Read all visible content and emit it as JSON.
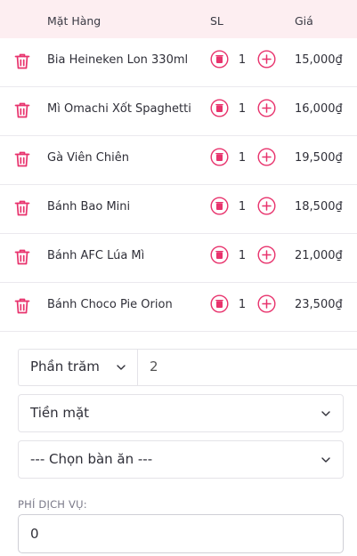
{
  "header": {
    "item": "Mặt Hàng",
    "qty": "SL",
    "price": "Giá"
  },
  "items": [
    {
      "name": "Bia Heineken Lon 330ml",
      "qty": "1",
      "price": "15,000₫"
    },
    {
      "name": "Mì Omachi Xốt Spaghetti",
      "qty": "1",
      "price": "16,000₫"
    },
    {
      "name": "Gà Viên Chiên",
      "qty": "1",
      "price": "19,500₫"
    },
    {
      "name": "Bánh Bao Mini",
      "qty": "1",
      "price": "18,500₫"
    },
    {
      "name": "Bánh AFC Lúa Mì",
      "qty": "1",
      "price": "21,000₫"
    },
    {
      "name": "Bánh Choco Pie Orion",
      "qty": "1",
      "price": "23,500₫"
    }
  ],
  "discount": {
    "type": "Phần trăm",
    "value": "2"
  },
  "payment_method": "Tiền mặt",
  "table_select": "--- Chọn bàn ăn ---",
  "service_fee": {
    "label": "PHÍ DỊCH VỤ:",
    "value": "0"
  },
  "icons": {
    "delete": "trash-icon",
    "decrease": "minus-circle-icon",
    "increase": "plus-circle-icon",
    "dropdown": "chevron-down-icon"
  },
  "colors": {
    "accent": "#e8336d",
    "header_bg": "#fdeef1"
  }
}
